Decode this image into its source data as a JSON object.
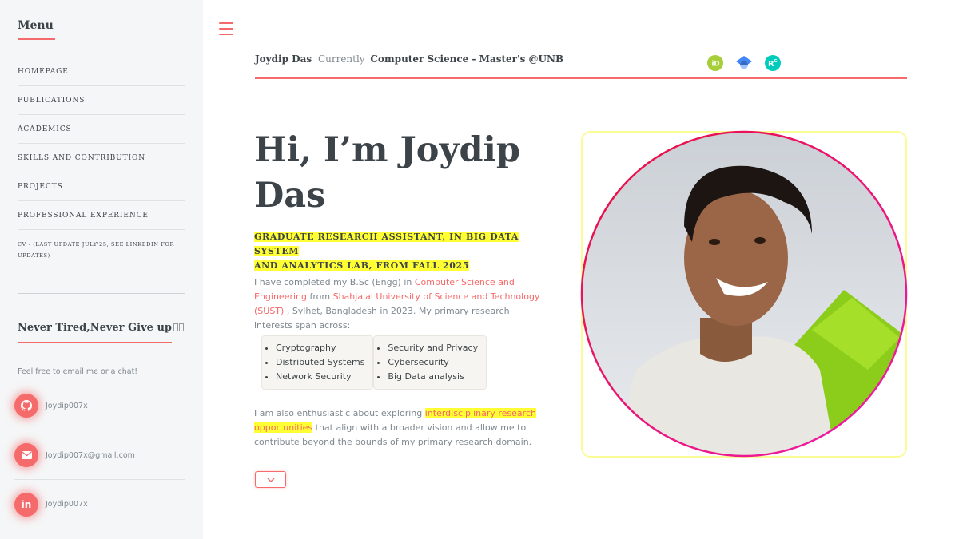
{
  "sidebar": {
    "menu_title": "Menu",
    "nav": [
      "HOMEPAGE",
      "PUBLICATIONS",
      "ACADEMICS",
      "SKILLS AND CONTRIBUTION",
      "PROJECTS",
      "PROFESSIONAL EXPERIENCE"
    ],
    "cv_line1": "CV - (LAST UPDATE JULY'25, SEE LINKEDIN FOR",
    "cv_line2": "UPDATES)",
    "never_title": "Never Tired,Never Give up",
    "feel_text": "Feel free to email me or a chat!",
    "contacts": [
      {
        "icon": "github-icon",
        "text": "Joydip007x"
      },
      {
        "icon": "envelope-icon",
        "text": "Joydip007x@gmail.com"
      },
      {
        "icon": "linkedin-icon",
        "text": "Joydip007x"
      }
    ]
  },
  "header": {
    "name": "Joydip Das",
    "currently": "Currently",
    "position": "Computer Science - Master's @UNB",
    "icons": [
      "orcid-icon",
      "google-scholar-icon",
      "researchgate-icon"
    ],
    "icon_colors": {
      "orcid": "#a6ce39",
      "scholar": "#4285f4",
      "researchgate": "#00ccbb"
    }
  },
  "hero": {
    "title_line1": "Hi, I’m Joydip",
    "title_line2": "Das",
    "subtitle_line1": "GRADUATE RESEARCH ASSISTANT, IN BIG DATA SYSTEM",
    "subtitle_line2": "AND ANALYTICS LAB, FROM FALL 2025",
    "p1_a": "I have completed my B.Sc (Engg) in ",
    "p1_link1": "Computer Science and Engineering",
    "p1_b": " from ",
    "p1_link2": "Shahjalal University of Science and Technology (SUST)",
    "p1_c": " , Sylhet, Bangladesh in 2023. My primary research interests span across:",
    "interests_col1": [
      "Cryptography",
      "Distributed Systems",
      "Network Security"
    ],
    "interests_col2": [
      "Security and Privacy",
      "Cybersecurity",
      "Big Data analysis"
    ],
    "p2_a": "I am also enthusiastic about exploring ",
    "p2_highlight": "interdisciplinary research opportunities",
    "p2_b": " that align with a broader vision and allow me to contribute beyond the bounds of my primary research domain."
  },
  "colors": {
    "accent": "#f56a6a",
    "highlight": "#ffff33",
    "text": "#3d4449",
    "muted": "#7f888f"
  }
}
